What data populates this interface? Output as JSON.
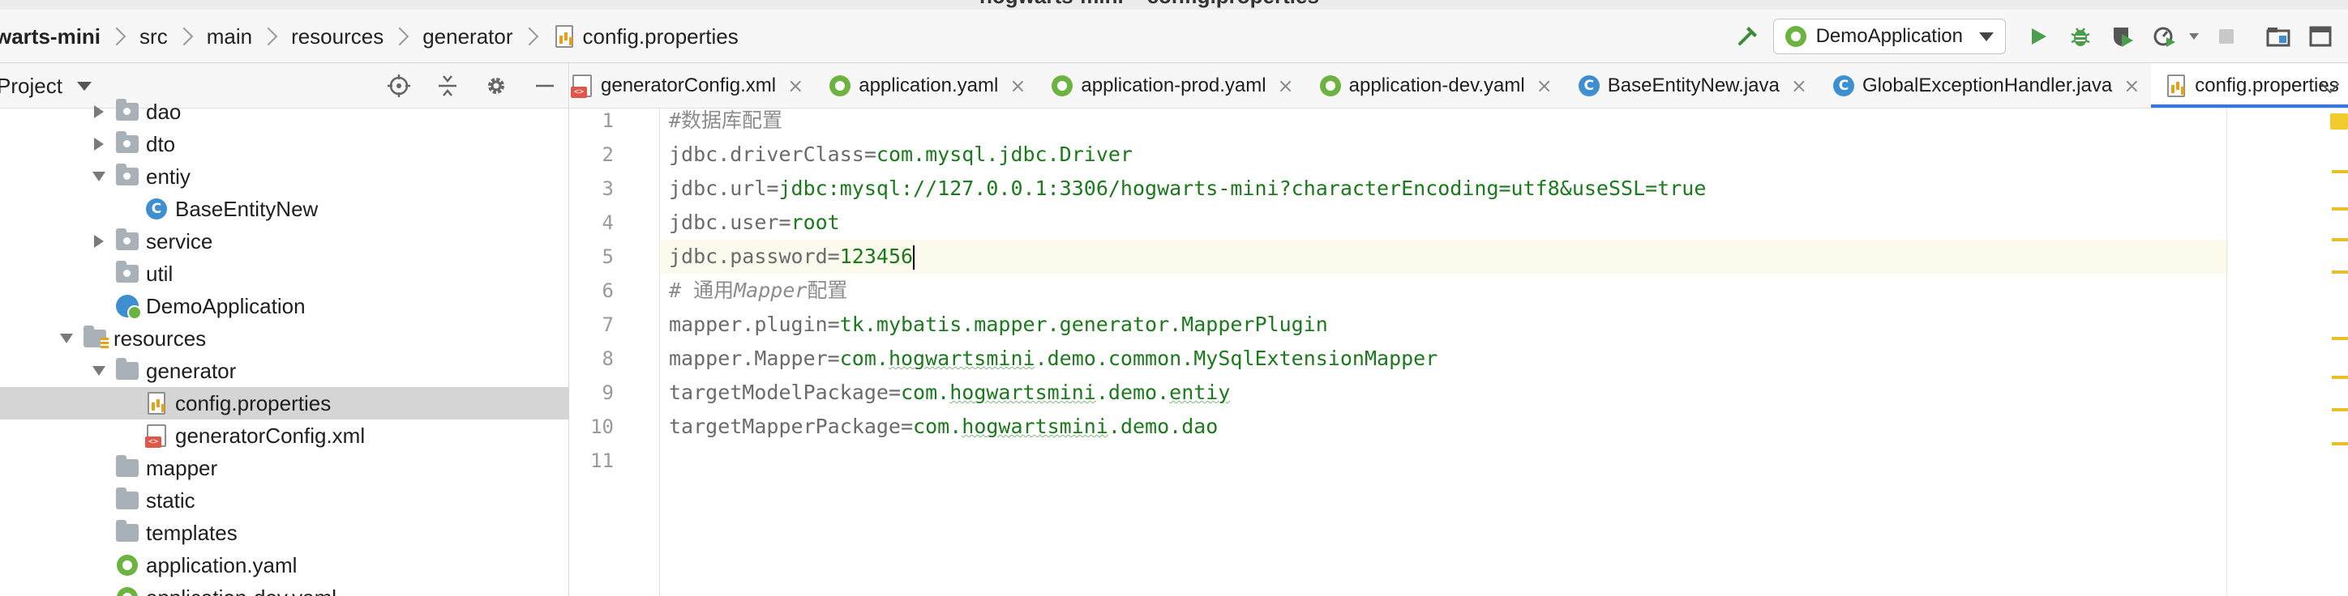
{
  "window": {
    "title": "hogwarts-mini – config.properties"
  },
  "breadcrumb": {
    "items": [
      "warts-mini",
      "src",
      "main",
      "resources",
      "generator",
      "config.properties"
    ]
  },
  "toolbar": {
    "run_config": "DemoApplication",
    "icons": [
      "hammer-icon",
      "run-icon",
      "debug-icon",
      "coverage-icon",
      "profile-icon",
      "stop-icon",
      "project-structure-icon",
      "layout-icon"
    ]
  },
  "project_pane": {
    "title": "Project",
    "tools": [
      "locate-icon",
      "collapse-icon",
      "gear-icon",
      "minimize-icon"
    ],
    "tree": [
      {
        "label": "dao",
        "type": "package",
        "arrow": "right",
        "indent": 1
      },
      {
        "label": "dto",
        "type": "package",
        "arrow": "right",
        "indent": 1
      },
      {
        "label": "entiy",
        "type": "package",
        "arrow": "down",
        "indent": 1
      },
      {
        "label": "BaseEntityNew",
        "type": "class",
        "arrow": "none",
        "indent": 2
      },
      {
        "label": "service",
        "type": "package",
        "arrow": "right",
        "indent": 1
      },
      {
        "label": "util",
        "type": "package",
        "arrow": "none",
        "indent": 1
      },
      {
        "label": "DemoApplication",
        "type": "app",
        "arrow": "none",
        "indent": 1
      },
      {
        "label": "resources",
        "type": "resources",
        "arrow": "down",
        "indent": 0
      },
      {
        "label": "generator",
        "type": "folder",
        "arrow": "down",
        "indent": 1
      },
      {
        "label": "config.properties",
        "type": "props",
        "arrow": "none",
        "indent": 2,
        "selected": true
      },
      {
        "label": "generatorConfig.xml",
        "type": "xml",
        "arrow": "none",
        "indent": 2
      },
      {
        "label": "mapper",
        "type": "folder",
        "arrow": "none",
        "indent": 1
      },
      {
        "label": "static",
        "type": "folder",
        "arrow": "none",
        "indent": 1
      },
      {
        "label": "templates",
        "type": "folder",
        "arrow": "none",
        "indent": 1
      },
      {
        "label": "application.yaml",
        "type": "yaml",
        "arrow": "none",
        "indent": 1
      },
      {
        "label": "application-dev.yaml",
        "type": "yaml",
        "arrow": "none",
        "indent": 1
      }
    ]
  },
  "tabs": [
    {
      "label": "generatorConfig.xml",
      "type": "xml",
      "active": false
    },
    {
      "label": "application.yaml",
      "type": "yaml",
      "active": false
    },
    {
      "label": "application-prod.yaml",
      "type": "yaml",
      "active": false
    },
    {
      "label": "application-dev.yaml",
      "type": "yaml",
      "active": false
    },
    {
      "label": "BaseEntityNew.java",
      "type": "class",
      "active": false
    },
    {
      "label": "GlobalExceptionHandler.java",
      "type": "class",
      "active": false
    },
    {
      "label": "config.properties",
      "type": "props",
      "active": true
    }
  ],
  "tab_close_glyph": "×",
  "editor": {
    "current_line": 5,
    "lines": [
      {
        "n": "1",
        "kind": "comment",
        "text": "#数据库配置"
      },
      {
        "n": "2",
        "kind": "prop",
        "key": "jdbc.driverClass",
        "value": "com.mysql.jdbc.Driver"
      },
      {
        "n": "3",
        "kind": "prop",
        "key": "jdbc.url",
        "value": "jdbc:mysql://127.0.0.1:3306/hogwarts-mini?characterEncoding=utf8&useSSL=true"
      },
      {
        "n": "4",
        "kind": "prop",
        "key": "jdbc.user",
        "value": "root"
      },
      {
        "n": "5",
        "kind": "prop",
        "key": "jdbc.password",
        "value": "123456"
      },
      {
        "n": "6",
        "kind": "comment2",
        "pre": "# 通用",
        "italic": "Mapper",
        "post": "配置"
      },
      {
        "n": "7",
        "kind": "prop",
        "key": "mapper.plugin",
        "value": "tk.mybatis.mapper.generator.MapperPlugin"
      },
      {
        "n": "8",
        "kind": "prop",
        "key": "mapper.Mapper",
        "value_pre": "com.",
        "value_squig": "hogwartsmini",
        "value_post": ".demo.common.MySqlExtensionMapper"
      },
      {
        "n": "9",
        "kind": "prop",
        "key": "targetModelPackage",
        "value_pre": "com.",
        "value_squig": "hogwartsmini",
        "value_post": ".demo.",
        "value_squig2": "entiy"
      },
      {
        "n": "10",
        "kind": "prop",
        "key": "targetMapperPackage",
        "value_pre": "com.",
        "value_squig": "hogwartsmini",
        "value_post": ".demo.dao"
      },
      {
        "n": "11",
        "kind": "empty"
      }
    ]
  },
  "colors": {
    "accent": "#3574f0",
    "string_value": "#1b7a1b",
    "key": "#6b6b6b",
    "current_line": "#fcfaed",
    "selection": "#d5d5d5",
    "warning_marker": "#e6c12a"
  }
}
